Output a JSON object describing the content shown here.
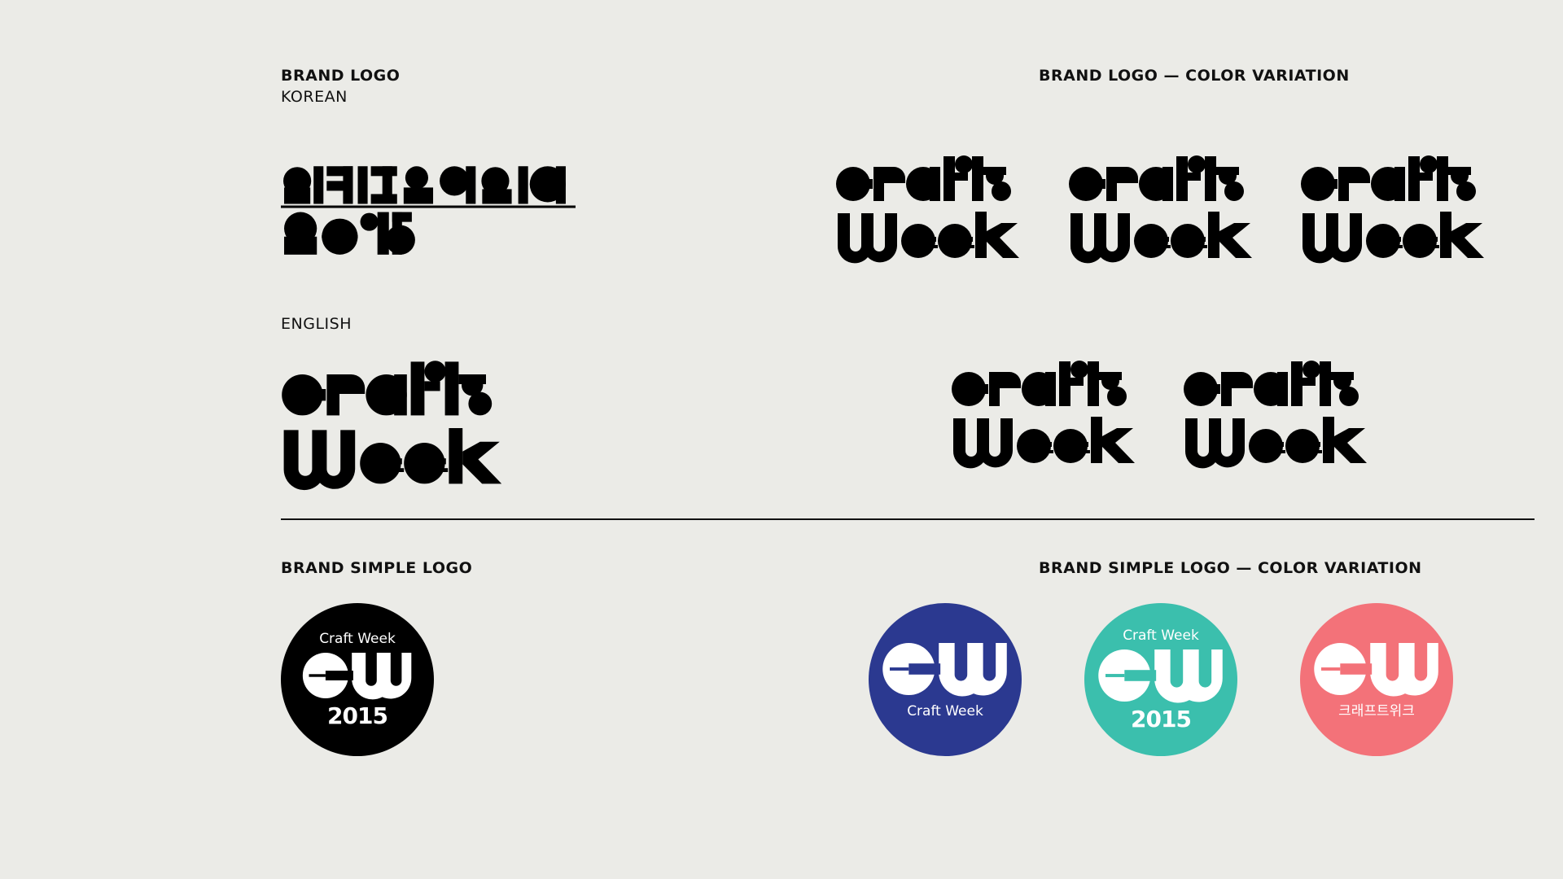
{
  "headings": {
    "brand_logo": "BRAND LOGO",
    "korean": "KOREAN",
    "english": "ENGLISH",
    "color_variation": "BRAND LOGO — COLOR VARIATION",
    "simple_logo": "BRAND SIMPLE LOGO",
    "simple_color_variation": "BRAND SIMPLE LOGO — COLOR VARIATION"
  },
  "wordmark": {
    "line1": "craft",
    "line2": "week",
    "korean_line1": "크래프트위크",
    "korean_line2": "2015"
  },
  "color_variants": [
    {
      "name": "navy",
      "color": "#2B3990"
    },
    {
      "name": "coral",
      "color": "#F37279"
    },
    {
      "name": "teal",
      "color": "#3BBFAD"
    },
    {
      "name": "gray",
      "color": "#C4C4C2"
    },
    {
      "name": "yellow",
      "color": "#EFCB3A"
    }
  ],
  "simple_logo": {
    "monogram": "CW",
    "main": {
      "color": "#000000",
      "top": "Craft Week",
      "bottom": "2015"
    },
    "variants": [
      {
        "color": "#2B3990",
        "top": "",
        "bottom": "Craft Week"
      },
      {
        "color": "#3BBFAD",
        "top": "Craft Week",
        "bottom": "2015"
      },
      {
        "color": "#F37279",
        "top": "",
        "bottom": "크래프트위크"
      }
    ]
  },
  "colors": {
    "background": "#EBEBE7",
    "ink": "#111111"
  }
}
